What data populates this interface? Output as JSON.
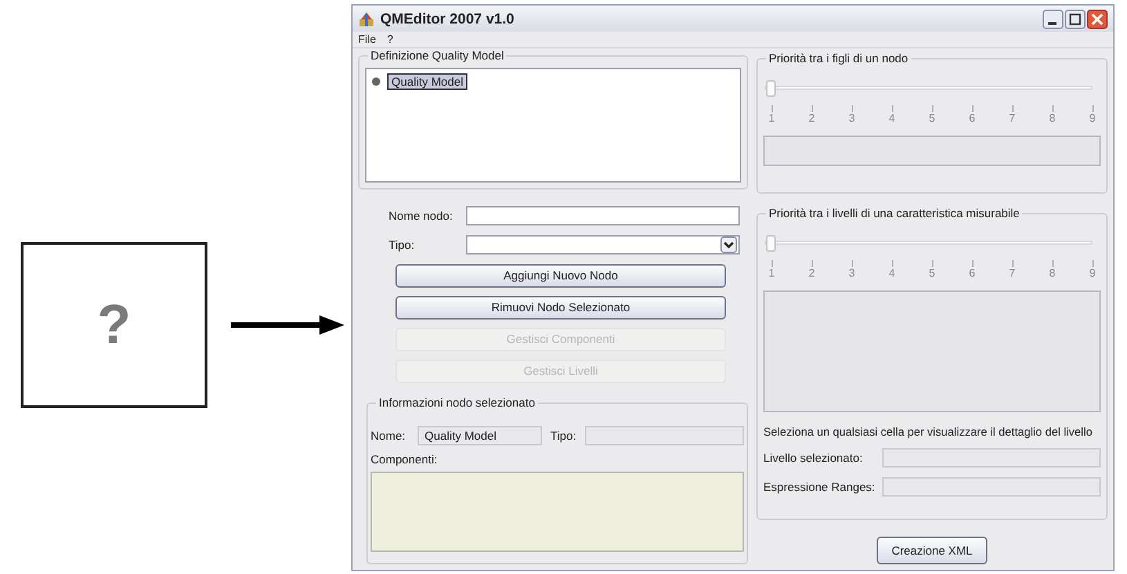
{
  "figure": {
    "symbol": "?"
  },
  "window": {
    "title": "QMEditor 2007 v1.0"
  },
  "menu": [
    "File",
    "?"
  ],
  "definition_panel": {
    "title": "Definizione Quality Model",
    "tree": [
      {
        "label": "Quality Model",
        "selected": true
      }
    ]
  },
  "form": {
    "fields": [
      {
        "label": "Nome nodo:",
        "kind": "text"
      },
      {
        "label": "Tipo:",
        "kind": "combo"
      }
    ],
    "buttons": [
      {
        "label": "Aggiungi Nuovo Nodo",
        "disabled": false
      },
      {
        "label": "Rimuovi Nodo Selezionato",
        "disabled": false
      },
      {
        "label": "Gestisci Componenti",
        "disabled": true
      },
      {
        "label": "Gestisci Livelli",
        "disabled": true
      }
    ]
  },
  "info_panel": {
    "title": "Informazioni nodo selezionato",
    "name_label": "Nome:",
    "name_value": "Quality Model",
    "type_label": "Tipo:",
    "components_label": "Componenti:"
  },
  "priority_panels": [
    {
      "title": "Priorità tra i figli di un nodo",
      "slider": {
        "level": 0,
        "disabled": true,
        "ticks": [
          "1",
          "2",
          "3",
          "4",
          "5",
          "6",
          "7",
          "8",
          "9"
        ]
      }
    },
    {
      "title": "Priorità tra i livelli di una caratteristica misurabile",
      "slider": {
        "level": 0,
        "disabled": true,
        "ticks": [
          "1",
          "2",
          "3",
          "4",
          "5",
          "6",
          "7",
          "8",
          "9"
        ]
      }
    }
  ],
  "levels_hint": "Seleziona un qualsiasi cella per visualizzare il dettaglio del livello",
  "detail_fields": [
    {
      "label": "Livello selezionato:"
    },
    {
      "label": "Espressione Ranges:"
    }
  ],
  "xml_button": "Creazione XML"
}
